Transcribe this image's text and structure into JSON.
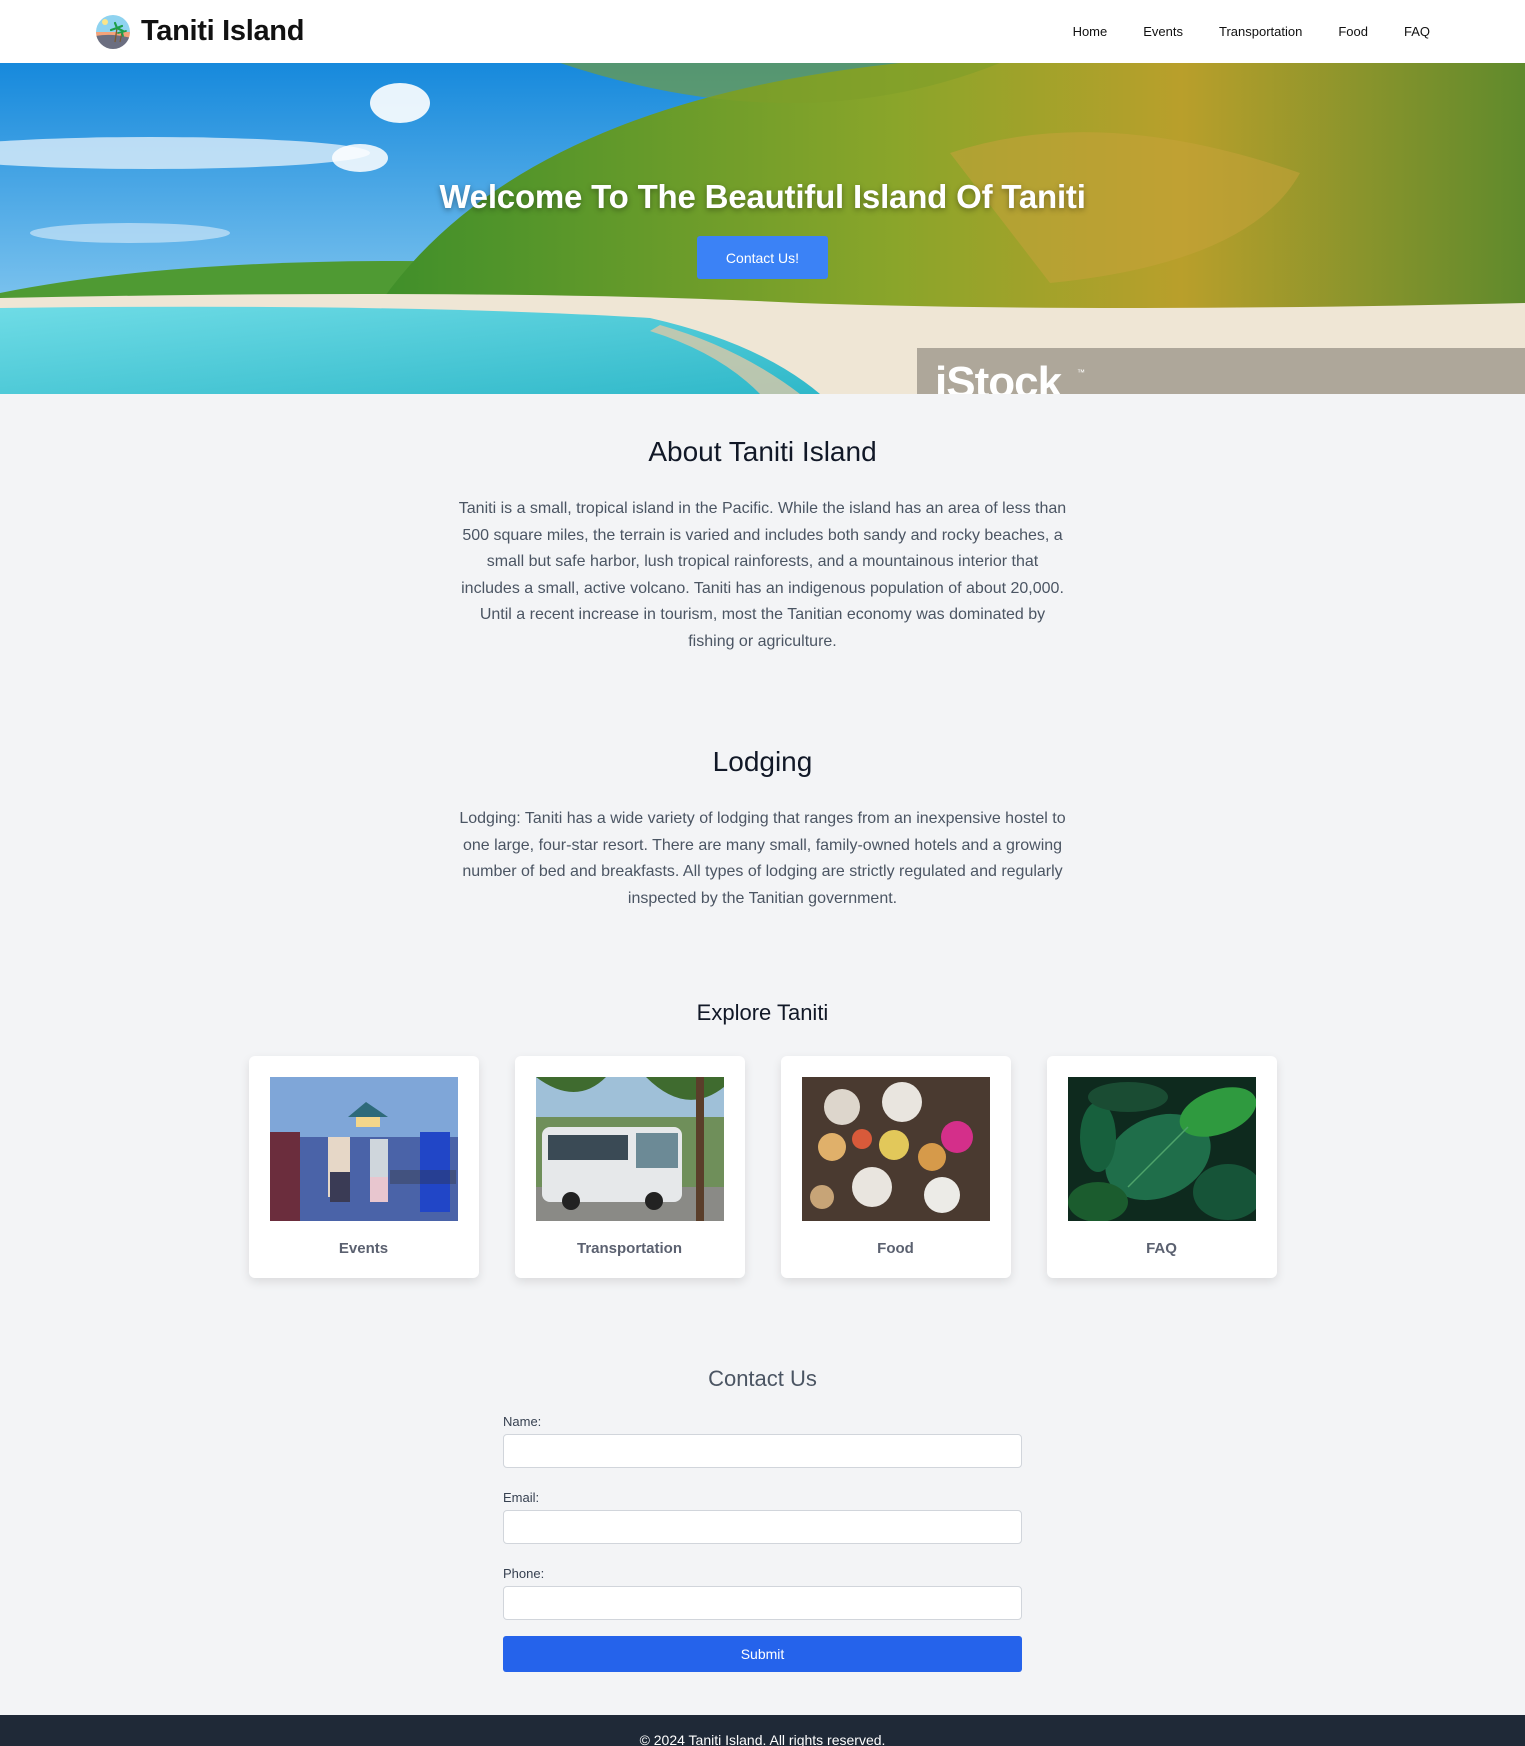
{
  "header": {
    "logo_icon": "tropical-beach-logo-icon",
    "title": "Taniti Island",
    "nav": [
      {
        "label": "Home"
      },
      {
        "label": "Events"
      },
      {
        "label": "Transportation"
      },
      {
        "label": "Food"
      },
      {
        "label": "FAQ"
      }
    ]
  },
  "hero": {
    "title": "Welcome To The Beautiful Island Of Taniti",
    "button_label": "Contact Us!",
    "watermark": "iStock",
    "watermark_tm": "™"
  },
  "about": {
    "title": "About Taniti Island",
    "body": "Taniti is a small, tropical island in the Pacific. While the island has an area of less than 500 square miles, the terrain is varied and includes both sandy and rocky beaches, a small but safe harbor, lush tropical rainforests, and a mountainous interior that includes a small, active volcano. Taniti has an indigenous population of about 20,000. Until a recent increase in tourism, most the Tanitian economy was dominated by fishing or agriculture."
  },
  "lodging": {
    "title": "Lodging",
    "body": "Lodging: Taniti has a wide variety of lodging that ranges from an inexpensive hostel to one large, four-star resort. There are many small, family-owned hotels and a growing number of bed and breakfasts. All types of lodging are strictly regulated and regularly inspected by the Tanitian government."
  },
  "explore": {
    "title": "Explore Taniti",
    "cards": [
      {
        "label": "Events",
        "image": "beach-party-photo"
      },
      {
        "label": "Transportation",
        "image": "bus-photo"
      },
      {
        "label": "Food",
        "image": "food-table-photo"
      },
      {
        "label": "FAQ",
        "image": "tropical-leaves-photo"
      }
    ]
  },
  "contact": {
    "title": "Contact Us",
    "fields": [
      {
        "label": "Name:",
        "value": "",
        "placeholder": ""
      },
      {
        "label": "Email:",
        "value": "",
        "placeholder": ""
      },
      {
        "label": "Phone:",
        "value": "",
        "placeholder": ""
      }
    ],
    "submit_label": "Submit"
  },
  "footer": {
    "text": "© 2024 Taniti Island. All rights reserved."
  },
  "colors": {
    "accent_button": "#3b82f6",
    "submit_button": "#2563eb",
    "footer_bg": "#1f2937",
    "page_bg": "#f3f4f6"
  }
}
